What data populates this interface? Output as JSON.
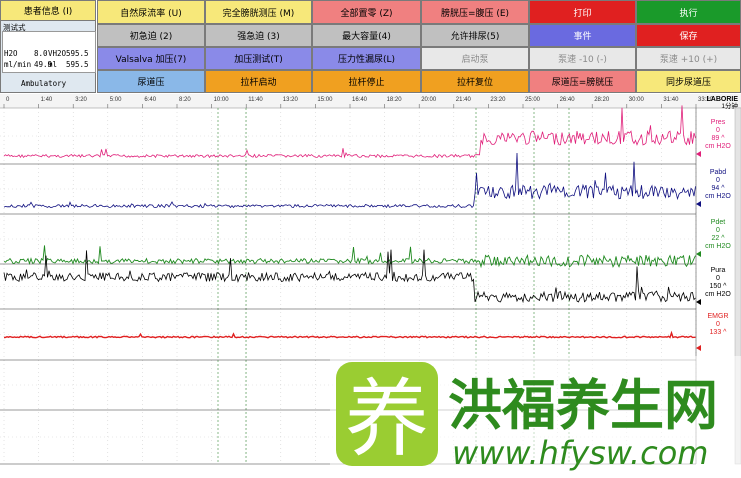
{
  "toolbar": {
    "patient_info": "患者信息 (I)",
    "row1": [
      {
        "label": "自然尿流率 (U)",
        "color": "#f7e87a"
      },
      {
        "label": "完全膀胱测压 (M)",
        "color": "#f7e87a"
      },
      {
        "label": "全部置零 (Z)",
        "color": "#f08080"
      },
      {
        "label": "膀胱压=腹压 (E)",
        "color": "#f08080"
      },
      {
        "label": "打印",
        "color": "#e02020"
      },
      {
        "label": "执行",
        "color": "#1a9a2a"
      }
    ],
    "row2": [
      {
        "label": "初急迫 (2)",
        "color": "#c0c0c0"
      },
      {
        "label": "强急迫 (3)",
        "color": "#c0c0c0"
      },
      {
        "label": "最大容量(4)",
        "color": "#c0c0c0"
      },
      {
        "label": "允许排尿(5)",
        "color": "#c0c0c0"
      },
      {
        "label": "事件",
        "color": "#6a6ae0"
      },
      {
        "label": "保存",
        "color": "#e02020"
      }
    ],
    "row3": [
      {
        "label": "Valsalva 加压(7)",
        "color": "#8a8ae8"
      },
      {
        "label": "加压测试(T)",
        "color": "#8a8ae8"
      },
      {
        "label": "压力性漏尿(L)",
        "color": "#8a8ae8"
      },
      {
        "label": "启动泵",
        "color": "#e8e8e8"
      },
      {
        "label": "泵速 -10 (-)",
        "color": "#e8e8e8"
      },
      {
        "label": "泵速 +10 (+)",
        "color": "#e8e8e8"
      }
    ],
    "row4": [
      {
        "label": "尿道压",
        "color": "#8ab8e8"
      },
      {
        "label": "拉杆启动",
        "color": "#f0a020"
      },
      {
        "label": "拉杆停止",
        "color": "#f0a020"
      },
      {
        "label": "拉杆复位",
        "color": "#f0a020"
      },
      {
        "label": "尿道压=膀胱压",
        "color": "#f08080"
      },
      {
        "label": "同步尿道压",
        "color": "#f7e87a"
      }
    ]
  },
  "patient_panel": {
    "mode": "测试式",
    "row1_left": "H2O",
    "row1_mid": "8.0",
    "row1_unit": "VH2O",
    "row1_right": "595.5",
    "row2_left": "ml/min",
    "row2_mid": "49.9",
    "row2_unit": "ml",
    "row2_right": "595.5",
    "footer": "Ambulatory"
  },
  "timeline": {
    "labels": [
      "0",
      "1:40",
      "3:20",
      "5:00",
      "6:40",
      "8:20",
      "10:00",
      "11:40",
      "13:20",
      "15:00",
      "16:40",
      "18:20",
      "20:00",
      "21:40",
      "23:20",
      "25:00",
      "26:40",
      "28:20",
      "30:00",
      "31:40",
      "33:20"
    ],
    "brand": "LABORIE",
    "scale": "1分钟"
  },
  "channels": [
    {
      "name": "Pres",
      "value": "0",
      "max": "89",
      "unit": "cm H2O",
      "color": "#e0207a"
    },
    {
      "name": "Pabd",
      "value": "0",
      "max": "94",
      "unit": "cm H2O",
      "color": "#101080"
    },
    {
      "name": "Pdet",
      "value": "0",
      "max": "22",
      "unit": "cm H2O",
      "color": "#208a20"
    },
    {
      "name": "Pura",
      "value": "0",
      "max": "150",
      "unit": "cm H2O",
      "color": "#000000"
    },
    {
      "name": "EMGR",
      "value": "0",
      "max": "133",
      "unit": "",
      "color": "#e02020"
    }
  ],
  "colors": {
    "grid": "#c8c8c8",
    "marker": "#3a8a3a"
  },
  "watermark": {
    "char": "养",
    "text": "洪福养生网",
    "url": "www.hfysw.com"
  }
}
